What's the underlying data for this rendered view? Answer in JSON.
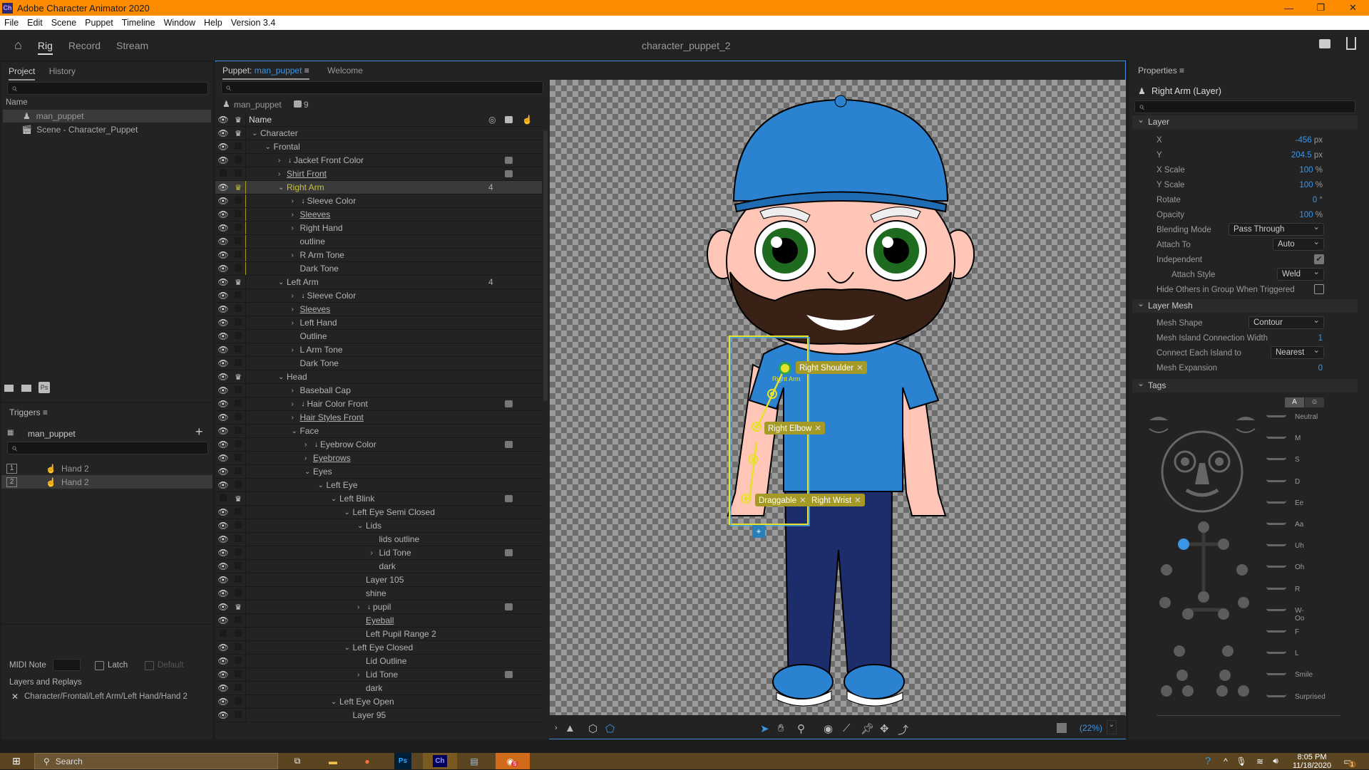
{
  "window": {
    "title": "Adobe Character Animator 2020",
    "app_logo": "Ch",
    "controls": [
      "minimize",
      "maximize",
      "close"
    ]
  },
  "menu": [
    "File",
    "Edit",
    "Scene",
    "Puppet",
    "Timeline",
    "Window",
    "Help",
    "Version 3.4"
  ],
  "workspace": {
    "tabs": [
      "Rig",
      "Record",
      "Stream"
    ],
    "active": "Rig",
    "document_title": "character_puppet_2"
  },
  "project_panel": {
    "tabs": [
      "Project",
      "History"
    ],
    "column_header": "Name",
    "items": [
      {
        "icon": "puppet-icon",
        "name": "man_puppet",
        "selected": true
      },
      {
        "icon": "scene-icon",
        "name": "Scene - Character_Puppet",
        "selected": false
      }
    ],
    "footer_icons": [
      "new-scene-icon",
      "new-folder-icon",
      "photoshop-icon"
    ]
  },
  "triggers_panel": {
    "title": "Triggers",
    "puppet_name": "man_puppet",
    "items": [
      {
        "key": "1",
        "name": "Hand 2",
        "selected": false
      },
      {
        "key": "2",
        "name": "Hand 2",
        "selected": true
      }
    ],
    "midi_note_label": "MIDI Note",
    "midi_note_value": "",
    "latch_label": "Latch",
    "latch_checked": false,
    "default_label": "Default",
    "default_checked": false,
    "layers_replays_label": "Layers and Replays",
    "layer_path": "Character/Frontal/Left Arm/Left Hand/Hand 2"
  },
  "puppet_panel": {
    "tabs": [
      {
        "prefix": "Puppet:",
        "name": "man_puppet"
      },
      {
        "name": "Welcome"
      }
    ],
    "puppet_name": "man_puppet",
    "tag_count": "9",
    "column_header": "Name",
    "layers": [
      {
        "name": "Character",
        "depth": 0,
        "expand": "open",
        "visible": true,
        "independent": true
      },
      {
        "name": "Frontal",
        "depth": 1,
        "expand": "open",
        "visible": true
      },
      {
        "name": "Jacket Front Color",
        "depth": 2,
        "expand": "closed",
        "visible": true,
        "clip": true,
        "tagged": true
      },
      {
        "name": "Shirt Front",
        "depth": 2,
        "expand": "closed",
        "visible": false,
        "underline": true,
        "tagged": true
      },
      {
        "name": "Right Arm",
        "depth": 2,
        "expand": "open",
        "visible": true,
        "independent": true,
        "selected": true,
        "count": "4"
      },
      {
        "name": "Sleeve Color",
        "depth": 3,
        "expand": "closed",
        "visible": true,
        "clip": true
      },
      {
        "name": "Sleeves",
        "depth": 3,
        "expand": "closed",
        "visible": true,
        "underline": true
      },
      {
        "name": "Right Hand",
        "depth": 3,
        "expand": "closed",
        "visible": true
      },
      {
        "name": "outline",
        "depth": 3,
        "visible": true
      },
      {
        "name": "R Arm Tone",
        "depth": 3,
        "expand": "closed",
        "visible": true
      },
      {
        "name": "Dark Tone",
        "depth": 3,
        "visible": true
      },
      {
        "name": "Left Arm",
        "depth": 2,
        "expand": "open",
        "visible": true,
        "independent": true,
        "count": "4"
      },
      {
        "name": "Sleeve Color",
        "depth": 3,
        "expand": "closed",
        "visible": true,
        "clip": true
      },
      {
        "name": "Sleeves",
        "depth": 3,
        "expand": "closed",
        "visible": true,
        "underline": true
      },
      {
        "name": "Left Hand",
        "depth": 3,
        "expand": "closed",
        "visible": true
      },
      {
        "name": "Outline",
        "depth": 3,
        "visible": true
      },
      {
        "name": "L Arm Tone",
        "depth": 3,
        "expand": "closed",
        "visible": true
      },
      {
        "name": "Dark Tone",
        "depth": 3,
        "visible": true
      },
      {
        "name": "Head",
        "depth": 2,
        "expand": "open",
        "visible": true,
        "independent": true
      },
      {
        "name": "Baseball Cap",
        "depth": 3,
        "expand": "closed",
        "visible": true
      },
      {
        "name": "Hair Color Front",
        "depth": 3,
        "expand": "closed",
        "visible": true,
        "clip": true,
        "tagged": true
      },
      {
        "name": "Hair Styles Front",
        "depth": 3,
        "expand": "closed",
        "visible": true,
        "underline": true
      },
      {
        "name": "Face",
        "depth": 3,
        "expand": "open",
        "visible": true
      },
      {
        "name": "Eyebrow Color",
        "depth": 4,
        "expand": "closed",
        "visible": true,
        "clip": true,
        "tagged": true
      },
      {
        "name": "Eyebrows",
        "depth": 4,
        "expand": "closed",
        "visible": true,
        "underline": true
      },
      {
        "name": "Eyes",
        "depth": 4,
        "expand": "open",
        "visible": true
      },
      {
        "name": "Left Eye",
        "depth": 5,
        "expand": "open",
        "visible": true
      },
      {
        "name": "Left Blink",
        "depth": 6,
        "expand": "open",
        "visible": false,
        "independent": true,
        "tagged": true
      },
      {
        "name": "Left Eye Semi Closed",
        "depth": 7,
        "expand": "open",
        "visible": true
      },
      {
        "name": "Lids",
        "depth": 8,
        "expand": "open",
        "visible": true
      },
      {
        "name": "lids outline",
        "depth": 9,
        "visible": true
      },
      {
        "name": "Lid Tone",
        "depth": 9,
        "expand": "closed",
        "visible": true,
        "tagged": true
      },
      {
        "name": "dark",
        "depth": 9,
        "visible": true
      },
      {
        "name": "Layer 105",
        "depth": 8,
        "visible": true
      },
      {
        "name": "shine",
        "depth": 8,
        "visible": true
      },
      {
        "name": "pupil",
        "depth": 8,
        "expand": "closed",
        "visible": true,
        "clip": true,
        "independent": true,
        "tagged": true
      },
      {
        "name": "Eyeball",
        "depth": 8,
        "visible": true,
        "underline": true
      },
      {
        "name": "Left Pupil Range 2",
        "depth": 8,
        "visible": false
      },
      {
        "name": "Left Eye Closed",
        "depth": 7,
        "expand": "open",
        "visible": true
      },
      {
        "name": "Lid Outline",
        "depth": 8,
        "visible": true
      },
      {
        "name": "Lid Tone",
        "depth": 8,
        "expand": "closed",
        "visible": true,
        "tagged": true
      },
      {
        "name": "dark",
        "depth": 8,
        "visible": true
      },
      {
        "name": "Left Eye Open",
        "depth": 6,
        "expand": "open",
        "visible": true
      },
      {
        "name": "Layer 95",
        "depth": 7,
        "visible": true
      }
    ]
  },
  "canvas": {
    "handles": [
      {
        "label": "Right Shoulder"
      },
      {
        "label": "Right Elbow"
      },
      {
        "label": "Draggable"
      },
      {
        "label": "Right Wrist"
      }
    ],
    "origin_label": "Right Arm",
    "zoom": "(22%)",
    "toolbar": [
      "expand-icon",
      "warning-icon",
      "mesh-icon",
      "contour-icon",
      "select-icon",
      "hand-icon",
      "zoom-icon",
      "origin-icon",
      "stick-icon",
      "pin-icon",
      "dragger-icon",
      "handle-icon",
      "transparency-icon"
    ]
  },
  "properties_panel": {
    "title": "Properties",
    "layer_title": "Right Arm (Layer)",
    "sections": {
      "layer": {
        "title": "Layer",
        "fields": [
          {
            "label": "X",
            "value": "-456",
            "unit": "px"
          },
          {
            "label": "Y",
            "value": "204.5",
            "unit": "px"
          },
          {
            "label": "X Scale",
            "value": "100",
            "unit": "%"
          },
          {
            "label": "Y Scale",
            "value": "100",
            "unit": "%"
          },
          {
            "label": "Rotate",
            "value": "0",
            "unit": "°"
          },
          {
            "label": "Opacity",
            "value": "100",
            "unit": "%"
          }
        ],
        "blending_mode_label": "Blending Mode",
        "blending_mode": "Pass Through",
        "attach_to_label": "Attach To",
        "attach_to": "Auto",
        "independent_label": "Independent",
        "independent": true,
        "attach_style_label": "Attach Style",
        "attach_style": "Weld",
        "hide_others_label": "Hide Others in Group When Triggered",
        "hide_others": false
      },
      "layer_mesh": {
        "title": "Layer Mesh",
        "mesh_shape_label": "Mesh Shape",
        "mesh_shape": "Contour",
        "island_width_label": "Mesh Island Connection Width",
        "island_width": "1",
        "connect_label": "Connect Each Island to",
        "connect": "Nearest",
        "expansion_label": "Mesh Expansion",
        "expansion": "0"
      },
      "tags": {
        "title": "Tags",
        "mode_buttons": [
          "A",
          "☺"
        ],
        "visemes": [
          "Neutral",
          "M",
          "S",
          "D",
          "Ee",
          "Aa",
          "Uh",
          "Oh",
          "R",
          "W-Oo",
          "F",
          "L",
          "Smile",
          "Surprised"
        ]
      }
    }
  },
  "taskbar": {
    "search_placeholder": "Search",
    "apps": [
      "task-view",
      "file-explorer",
      "firefox",
      "photoshop",
      "character-animator",
      "notepad",
      "discord"
    ],
    "discord_badge": "5",
    "time": "8:05 PM",
    "date": "11/18/2020",
    "notification_badge": "1"
  },
  "colors": {
    "accent": "#3c96e6",
    "title_bar": "#ff8c00",
    "handle": "#e6e22a",
    "selected_layer": "#c8c23a"
  }
}
